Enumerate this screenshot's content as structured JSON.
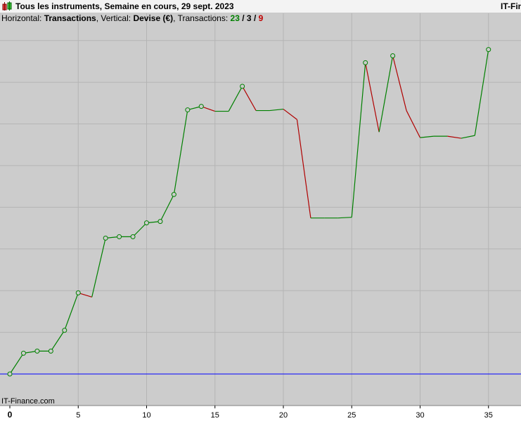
{
  "title": "Tous les instruments, Semaine en cours, 29 sept. 2023",
  "brand_right": "IT-Fin",
  "footer_brand": "IT-Finance.com",
  "legend": {
    "horizontal_label": "Horizontal:",
    "horizontal_value": "Transactions",
    "vertical_label": "Vertical:",
    "vertical_value": "Devise (€)",
    "transactions_label": "Transactions:",
    "count_green": "23",
    "sep1": "/",
    "count_neutral": "3",
    "sep2": "/",
    "count_red": "9"
  },
  "colors": {
    "plot_background": "#cccccc",
    "grid": "#b4b4b4",
    "gain": "#008000",
    "loss": "#b00000",
    "baseline": "#0000ff"
  },
  "chart_data": {
    "type": "line",
    "xlabel": "Transactions",
    "ylabel": "Devise (€)",
    "xlim": [
      0,
      37
    ],
    "x_ticks": [
      0,
      5,
      10,
      15,
      20,
      25,
      30,
      35
    ],
    "y_gridlines": 9,
    "baseline": true,
    "legend": "none",
    "series": [
      {
        "x": [
          0,
          1,
          2,
          3,
          4,
          5,
          6,
          7,
          8,
          9,
          10,
          11,
          12,
          13,
          14,
          15,
          16,
          17,
          18,
          19,
          20,
          21,
          22,
          23,
          24,
          25,
          26,
          27,
          28,
          29,
          30,
          31,
          32,
          33,
          34,
          35
        ],
        "y": [
          0,
          30,
          33,
          33,
          63,
          117,
          111,
          196,
          198,
          198,
          218,
          220,
          259,
          381,
          386,
          379,
          379,
          415,
          380,
          380,
          382,
          367,
          225,
          225,
          225,
          226,
          449,
          349,
          459,
          380,
          341,
          343,
          343,
          340,
          344,
          468
        ],
        "markers": [
          0,
          1,
          2,
          3,
          4,
          5,
          7,
          8,
          9,
          10,
          11,
          12,
          13,
          14,
          17,
          26,
          28,
          35
        ]
      }
    ]
  }
}
